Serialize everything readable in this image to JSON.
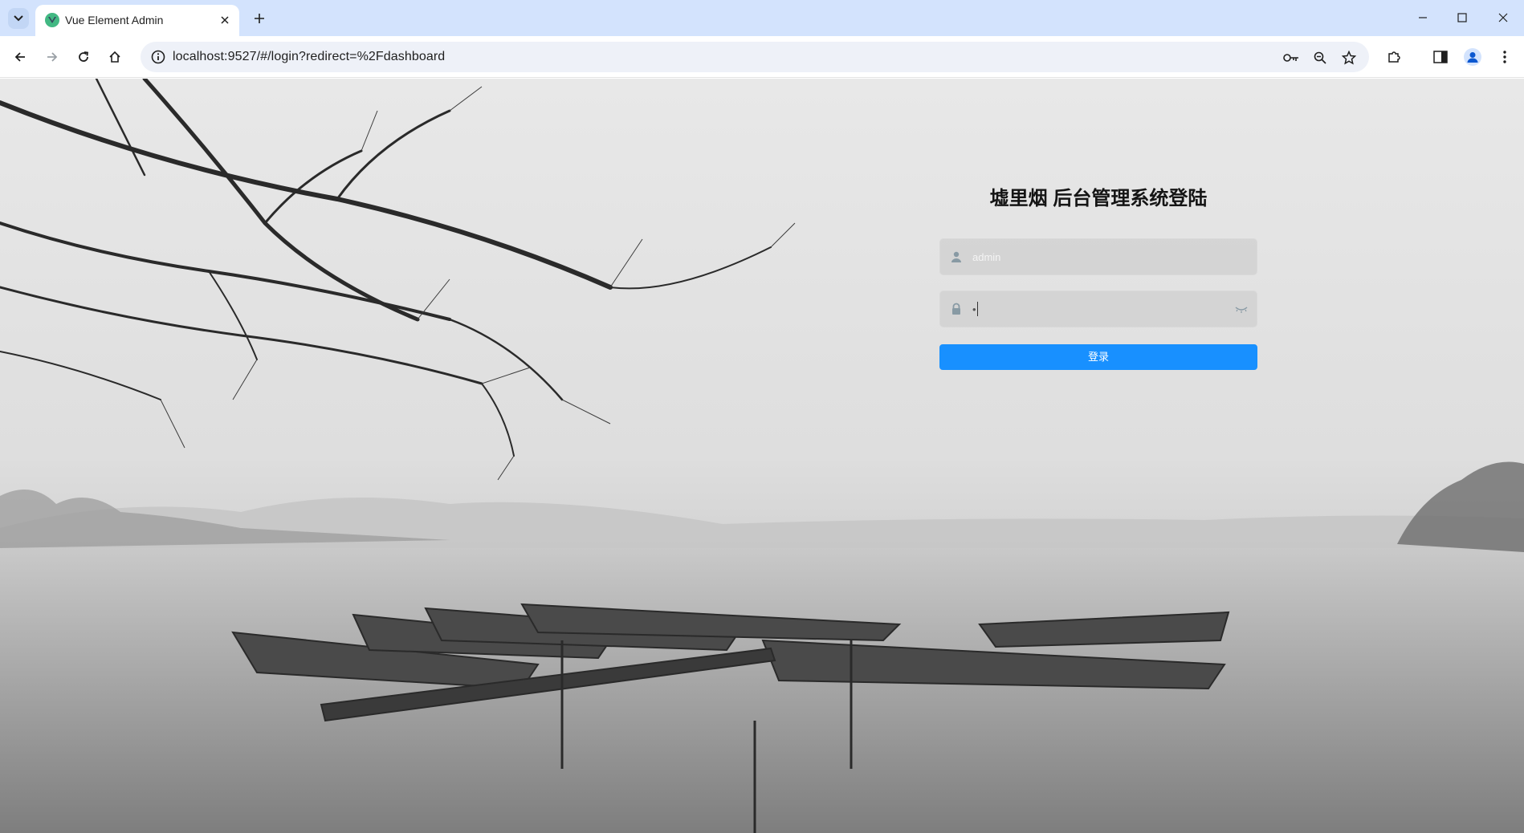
{
  "browser": {
    "tab_title": "Vue Element Admin",
    "url": "localhost:9527/#/login?redirect=%2Fdashboard"
  },
  "login": {
    "title": "墟里烟 后台管理系统登陆",
    "username_placeholder": "admin",
    "password_value": "•",
    "submit_label": "登录"
  },
  "colors": {
    "primary_button": "#1890ff",
    "chrome_titlebar": "#d3e3fd",
    "omnibox": "#eef1f8"
  },
  "icons": {
    "tab_favicon": "vue-logo-icon",
    "username_field": "user-icon",
    "password_field": "lock-icon",
    "password_toggle": "eye-closed-icon"
  }
}
